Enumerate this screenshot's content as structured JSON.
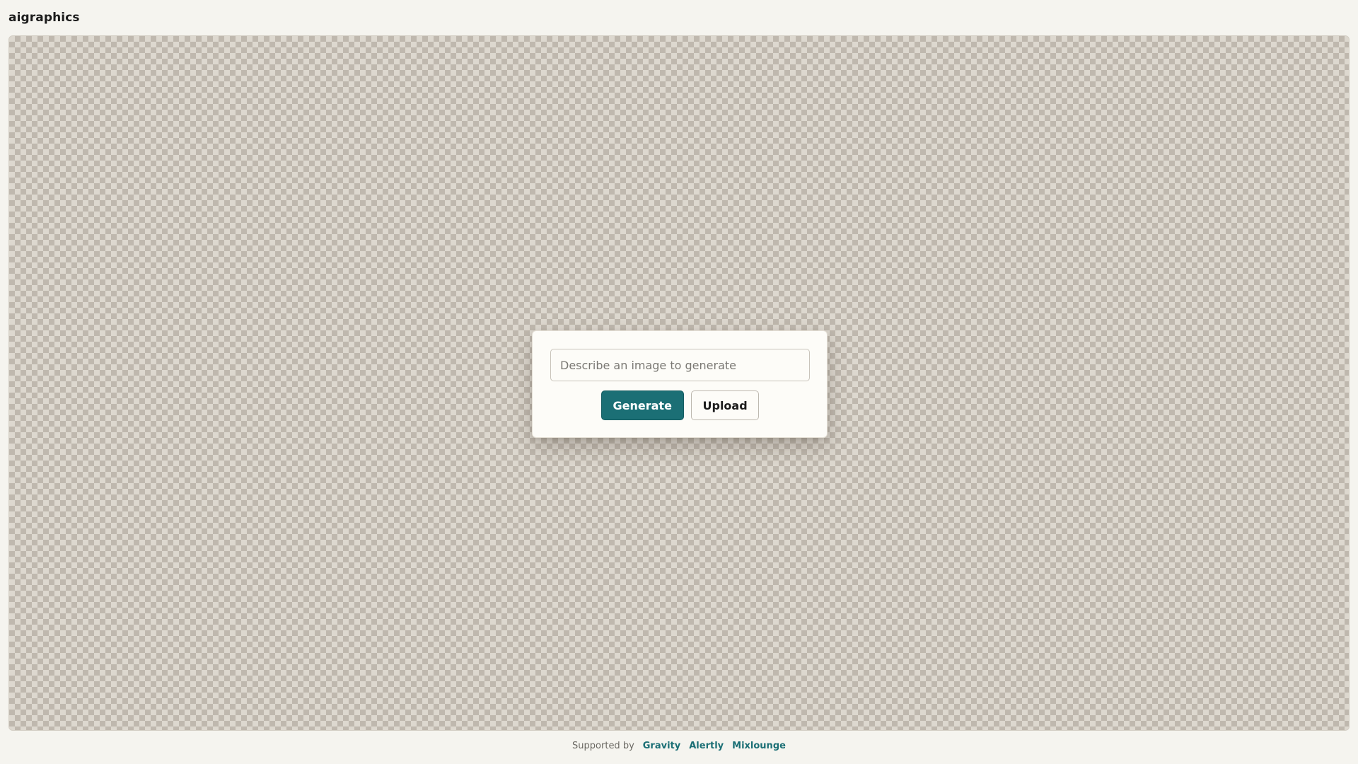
{
  "app": {
    "title": "aigraphics"
  },
  "prompt_panel": {
    "input_placeholder": "Describe an image to generate",
    "input_value": "",
    "generate_label": "Generate",
    "upload_label": "Upload"
  },
  "footer": {
    "supported_label": "Supported by",
    "sponsors": [
      {
        "label": "Gravity"
      },
      {
        "label": "Alertly"
      },
      {
        "label": "Mixlounge"
      }
    ]
  },
  "colors": {
    "accent": "#1b6f75",
    "page_background": "#f5f4ef",
    "checker_light": "#ddd8cf",
    "checker_dark": "#bfb8ae",
    "panel_background": "#fdfcf8"
  },
  "icons": {
    "canvas_background": "transparency-checkerboard"
  }
}
